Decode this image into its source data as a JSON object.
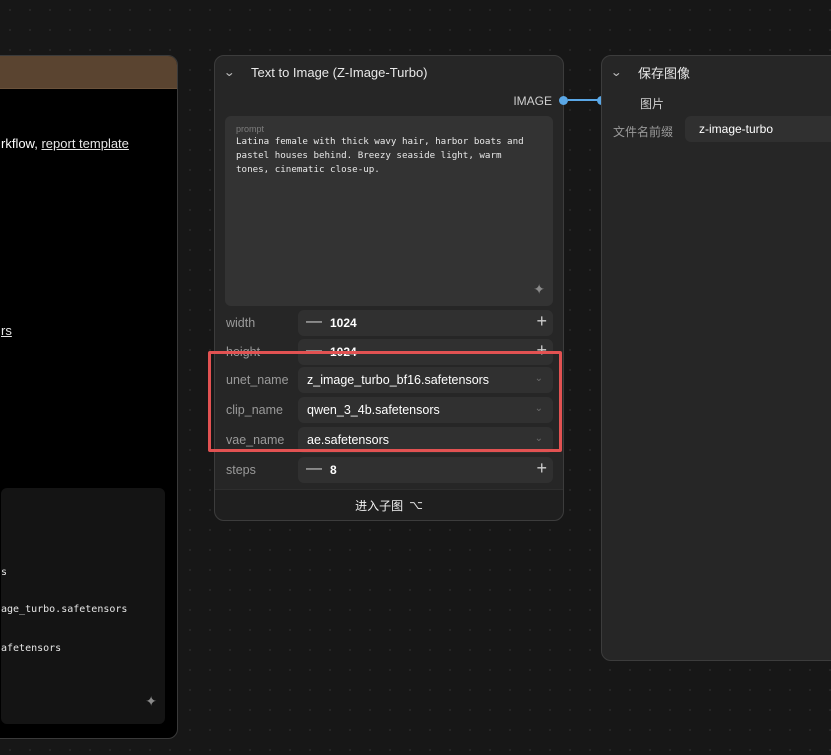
{
  "left_node": {
    "text_line1": "rkflow,",
    "link1": "report template",
    "link2": "rs",
    "code_lines": [
      "s",
      "age_turbo.safetensors",
      "afetensors"
    ]
  },
  "text_to_image_node": {
    "title": "Text to Image (Z-Image-Turbo)",
    "output_label": "IMAGE",
    "prompt_label": "prompt",
    "prompt_text": "Latina female with thick wavy hair, harbor boats and pastel houses behind. Breezy seaside light, warm tones, cinematic close-up.",
    "widgets": {
      "width": {
        "label": "width",
        "value": "1024"
      },
      "height": {
        "label": "height",
        "value": "1024"
      },
      "unet_name": {
        "label": "unet_name",
        "value": "z_image_turbo_bf16.safetensors"
      },
      "clip_name": {
        "label": "clip_name",
        "value": "qwen_3_4b.safetensors"
      },
      "vae_name": {
        "label": "vae_name",
        "value": "ae.safetensors"
      },
      "steps": {
        "label": "steps",
        "value": "8"
      }
    },
    "footer_button": "进入子图"
  },
  "save_image_node": {
    "title": "保存图像",
    "input_label": "图片",
    "filename_prefix_label": "文件名前缀",
    "filename_prefix_value": "z-image-turbo"
  },
  "colors": {
    "link": "#5aa7e6",
    "highlight": "#e25252",
    "left_header": "#5a4430"
  },
  "icons": [
    "chevron-down-icon",
    "sparkle-icon",
    "subgraph-icon",
    "minus-icon",
    "plus-icon"
  ]
}
